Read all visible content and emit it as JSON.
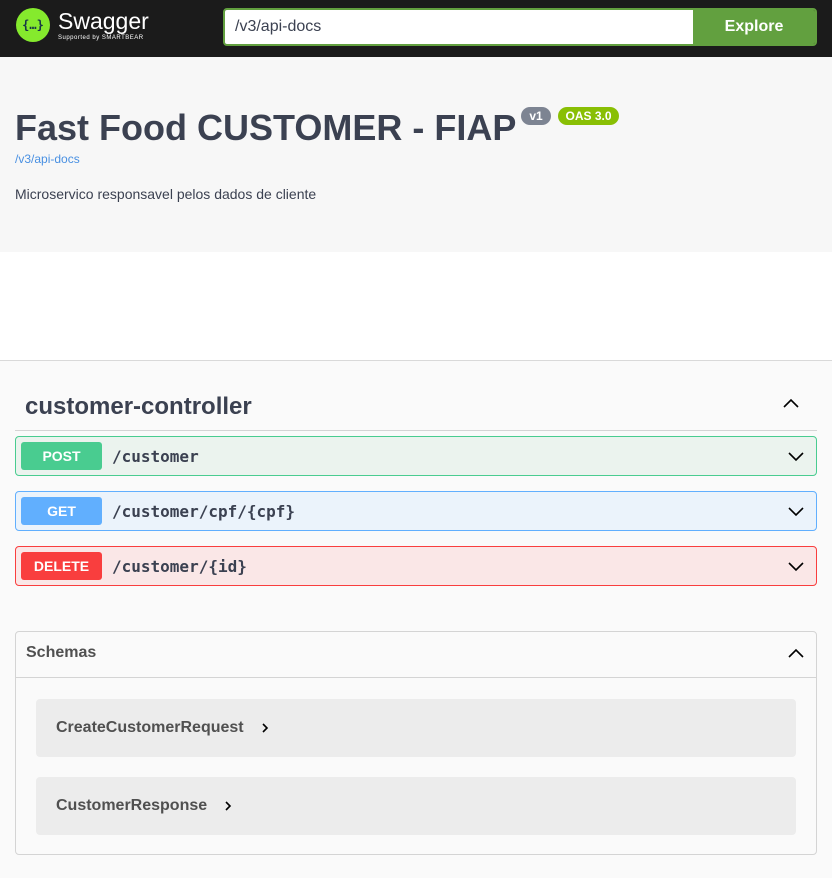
{
  "topbar": {
    "logo_name": "Swagger",
    "logo_sub": "Supported by SMARTBEAR",
    "logo_icon": "swagger-braces-icon",
    "url_value": "/v3/api-docs",
    "explore_label": "Explore"
  },
  "info": {
    "title": "Fast Food CUSTOMER - FIAP",
    "version_badge": "v1",
    "oas_badge": "OAS 3.0",
    "api_link": "/v3/api-docs",
    "description": "Microservico responsavel pelos dados de cliente"
  },
  "tag": {
    "title": "customer-controller",
    "operations": [
      {
        "method": "POST",
        "path": "/customer"
      },
      {
        "method": "GET",
        "path": "/customer/cpf/{cpf}"
      },
      {
        "method": "DELETE",
        "path": "/customer/{id}"
      }
    ]
  },
  "schemas": {
    "title": "Schemas",
    "models": [
      {
        "name": "CreateCustomerRequest"
      },
      {
        "name": "CustomerResponse"
      }
    ]
  },
  "colors": {
    "post": "#49cc90",
    "get": "#61affe",
    "delete": "#f93e3e",
    "explore": "#62a03f",
    "logo": "#85ea2d"
  }
}
